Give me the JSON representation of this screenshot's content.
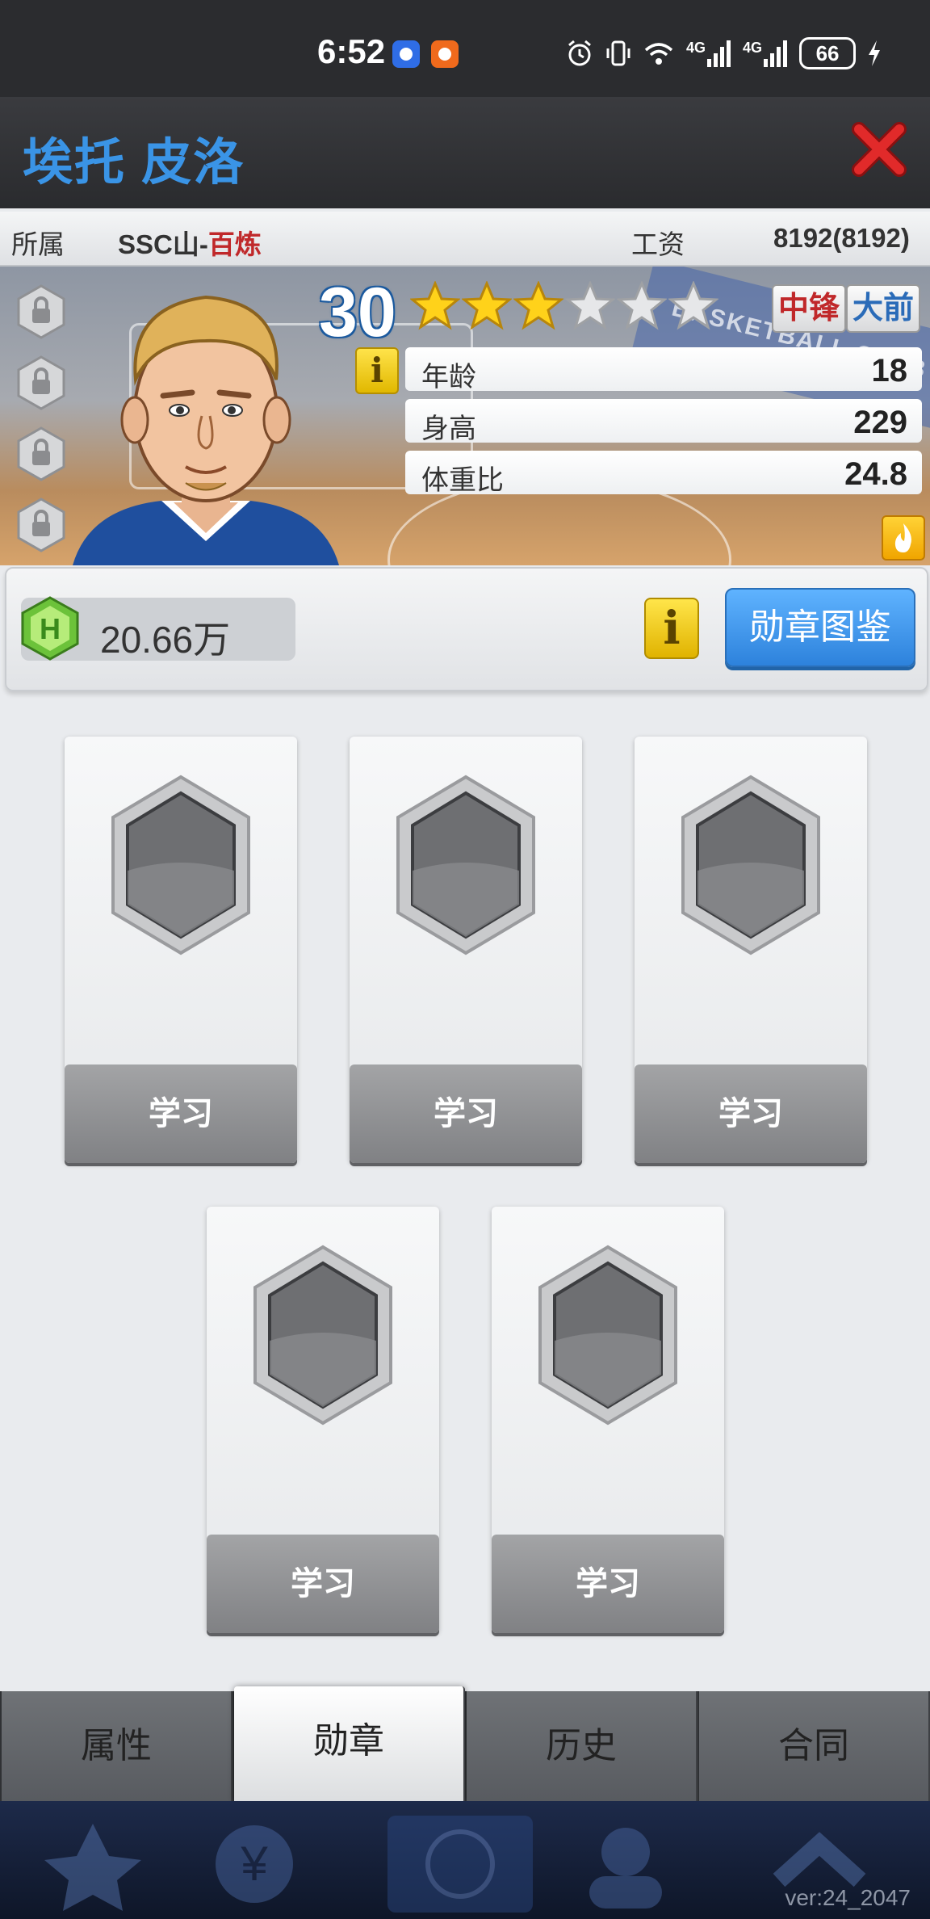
{
  "status_bar": {
    "time": "6:52",
    "network_1": "4G",
    "network_2": "4G",
    "battery": "66",
    "icons": [
      "alarm-icon",
      "vibrate-icon",
      "wifi-icon",
      "signal-icon",
      "signal-icon",
      "battery-icon",
      "charging-icon"
    ]
  },
  "header": {
    "player_name": "埃托 皮洛"
  },
  "team_row": {
    "team_label": "所属",
    "team_prefix": "SSC山-",
    "team_suffix": "百炼",
    "salary_label": "工资",
    "salary_value": "8192(8192)"
  },
  "player": {
    "level": "30",
    "stars_filled": 3,
    "stars_total": 6,
    "positions": [
      {
        "label": "中锋",
        "color": "#c0282a"
      },
      {
        "label": "大前",
        "color": "#2a6bb8"
      }
    ],
    "info_label": "i",
    "stats": [
      {
        "label": "年龄",
        "value": "18"
      },
      {
        "label": "身高",
        "value": "229"
      },
      {
        "label": "体重比",
        "value": "24.8"
      }
    ]
  },
  "currency": {
    "amount": "20.66万",
    "info_label": "i",
    "guide_button": "勋章图鉴"
  },
  "badges": {
    "slots": [
      {
        "button": "学习"
      },
      {
        "button": "学习"
      },
      {
        "button": "学习"
      },
      {
        "button": "学习"
      },
      {
        "button": "学习"
      }
    ]
  },
  "tabs": [
    {
      "label": "属性",
      "active": false
    },
    {
      "label": "勋章",
      "active": true
    },
    {
      "label": "历史",
      "active": false
    },
    {
      "label": "合同",
      "active": false
    }
  ],
  "footer": {
    "version": "ver:24_2047"
  },
  "colors": {
    "title_blue": "#3a94e6",
    "team_red": "#c0282a",
    "accent_button": "#3a8fe8"
  }
}
